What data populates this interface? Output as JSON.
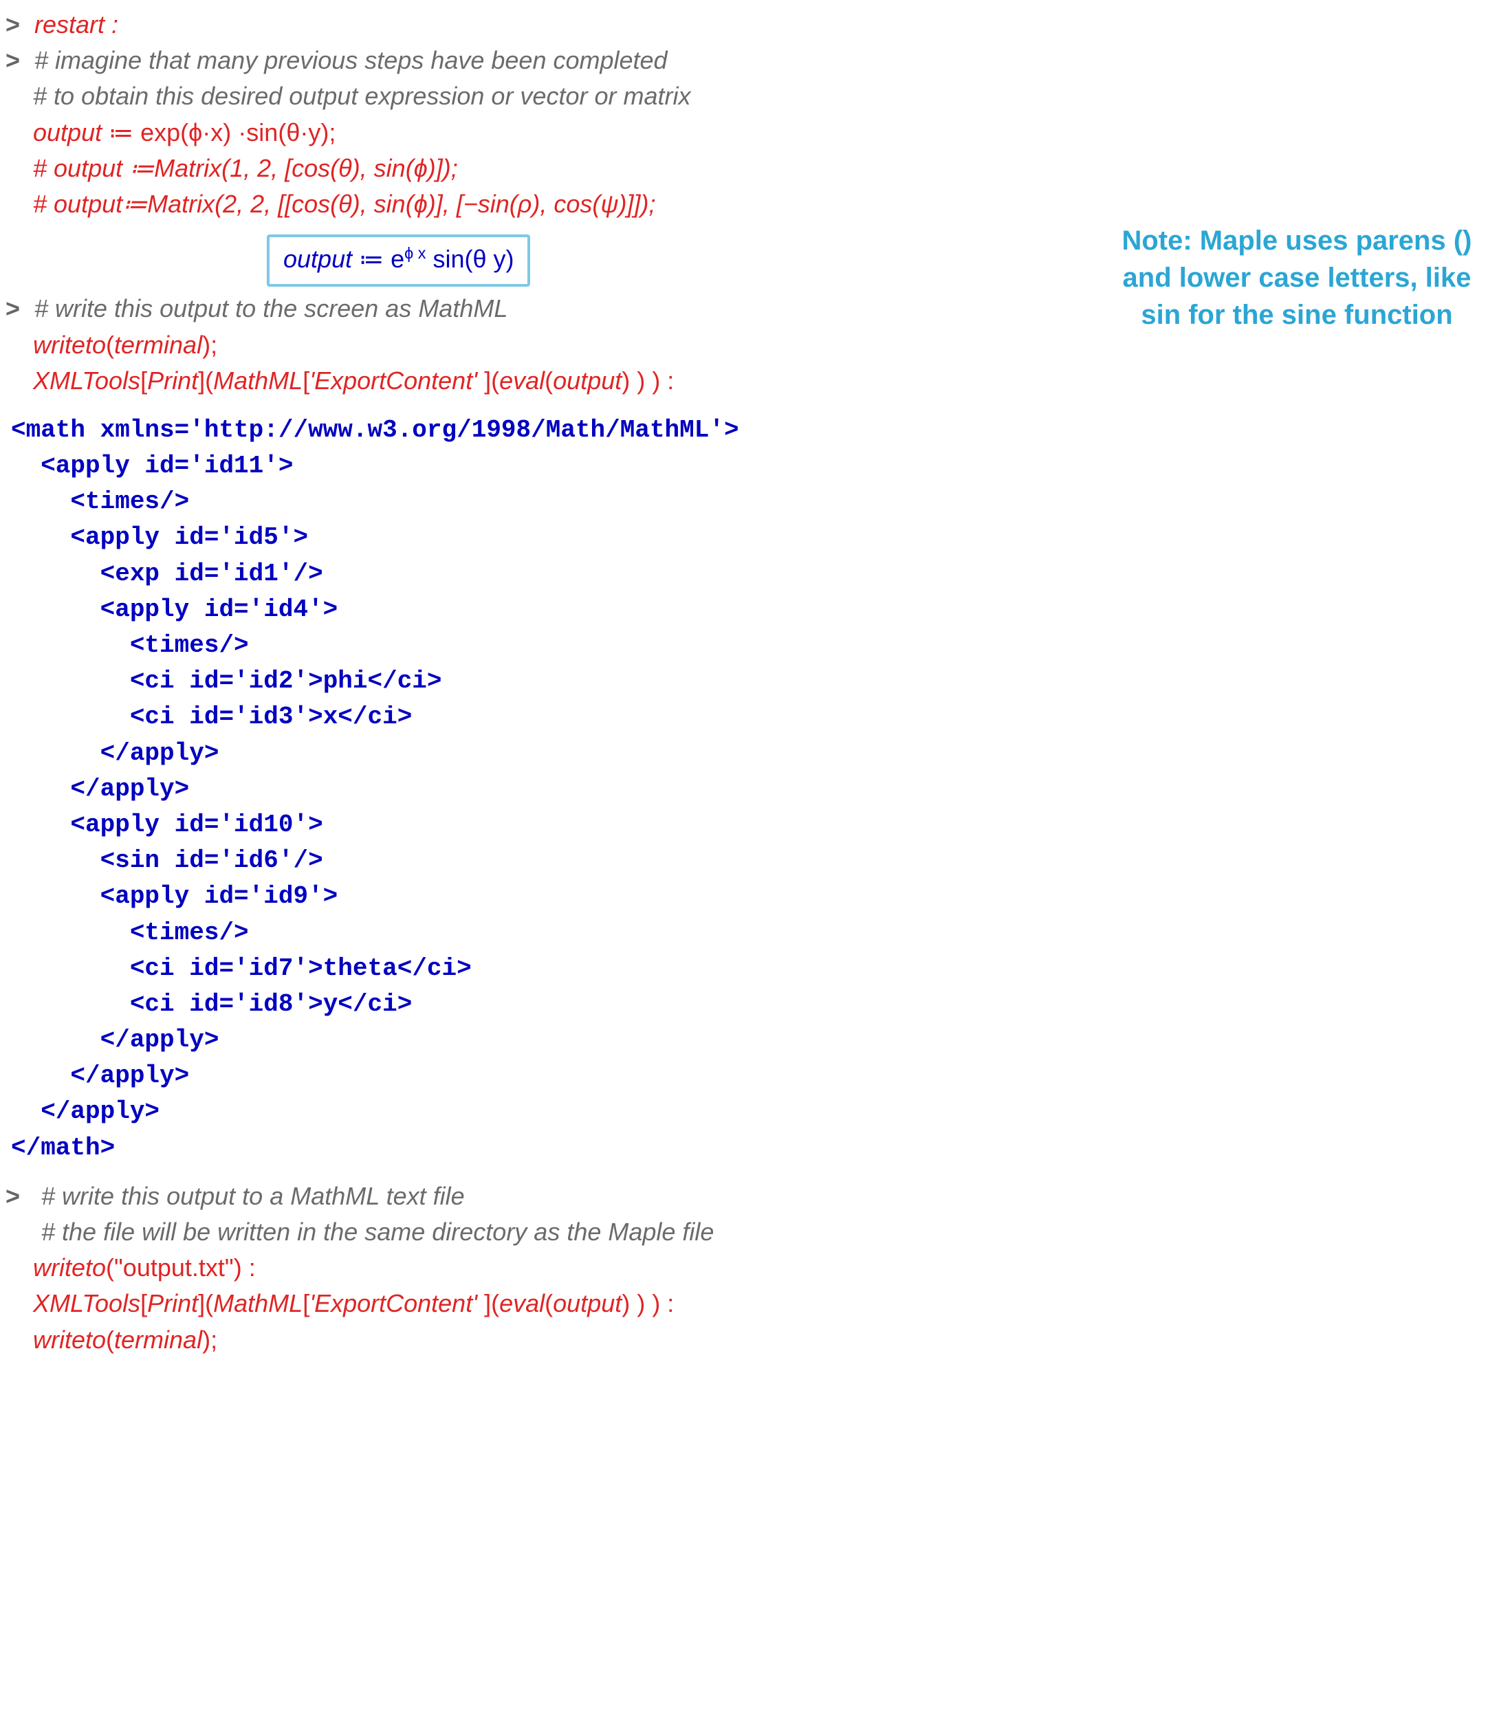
{
  "prompts": {
    "p": ">"
  },
  "block1": {
    "restart": "restart :",
    "c1": "# imagine that many previous steps have been completed",
    "c2": "# to obtain this desired output expression or vector or matrix",
    "assign_lhs": " output",
    "assign_op": " ≔ ",
    "assign_rhs_a": "exp",
    "assign_rhs_b": "(ϕ·x)",
    "assign_rhs_c": " ·",
    "assign_rhs_d": "sin",
    "assign_rhs_e": "(θ·y)",
    "assign_rhs_end": ";",
    "c3": "# output ≔Matrix(1, 2, [cos(θ), sin(ϕ)]);",
    "c4": "# output≔Matrix(2, 2, [[cos(θ), sin(ϕ)], [−sin(ρ), cos(ψ)]]);"
  },
  "outputBox": {
    "lhs": "output",
    "assign": " ≔ ",
    "e": "e",
    "superscript": "ϕ x",
    "sin": " sin(θ y)"
  },
  "note": "Note: Maple uses parens () and lower case letters, like sin for the sine function",
  "block2": {
    "c1": "# write this output to the screen as MathML",
    "l1a": "writeto",
    "l1b": "(",
    "l1c": "terminal",
    "l1d": ")",
    "l1e": ";",
    "l2a": "XMLTools",
    "l2b": "[",
    "l2c": "Print",
    "l2d": "]",
    "l2e": "(",
    "l2f": "MathML",
    "l2g": "[",
    "l2h": "'ExportContent'",
    "l2i": " ]",
    "l2j": "(",
    "l2k": "eval",
    "l2l": "(",
    "l2m": "output",
    "l2n": ") ) )",
    "l2o": " :"
  },
  "mathml": {
    "l00": "<math xmlns='http://www.w3.org/1998/Math/MathML'>",
    "l01": "  <apply id='id11'>",
    "l02": "    <times/>",
    "l03": "    <apply id='id5'>",
    "l04": "      <exp id='id1'/>",
    "l05": "      <apply id='id4'>",
    "l06": "        <times/>",
    "l07a": "        <ci id='id2'>",
    "l07b": "phi",
    "l07c": "</ci>",
    "l08a": "        <ci id='id3'>",
    "l08b": "x",
    "l08c": "</ci>",
    "l09": "      </apply>",
    "l10": "    </apply>",
    "l11": "    <apply id='id10'>",
    "l12": "      <sin id='id6'/>",
    "l13": "      <apply id='id9'>",
    "l14": "        <times/>",
    "l15a": "        <ci id='id7'>",
    "l15b": "theta",
    "l15c": "</ci>",
    "l16a": "        <ci id='id8'>",
    "l16b": "y",
    "l16c": "</ci>",
    "l17": "      </apply>",
    "l18": "    </apply>",
    "l19": "  </apply>",
    "l20": "</math>"
  },
  "block3": {
    "c1": "# write this output to a MathML text file",
    "c2": "# the file will be written in the same directory as the Maple file",
    "l1a": "writeto",
    "l1b": "(",
    "l1c": "\"output.txt\"",
    "l1d": ")",
    "l1e": " :",
    "l2a": "XMLTools",
    "l2b": "[",
    "l2c": "Print",
    "l2d": "]",
    "l2e": "(",
    "l2f": "MathML",
    "l2g": "[",
    "l2h": "'ExportContent'",
    "l2i": " ]",
    "l2j": "(",
    "l2k": "eval",
    "l2l": "(",
    "l2m": "output",
    "l2n": ") ) )",
    "l2o": " :",
    "l3a": "writeto",
    "l3b": "(",
    "l3c": "terminal",
    "l3d": ")",
    "l3e": ";"
  }
}
